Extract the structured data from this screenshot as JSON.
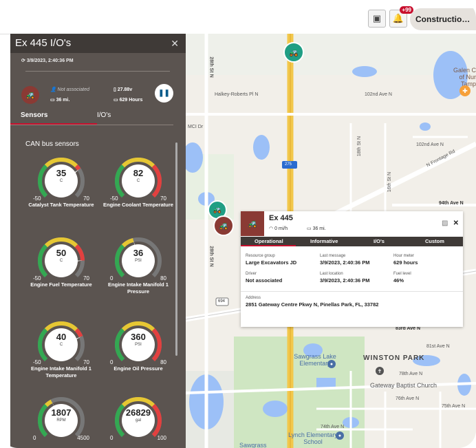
{
  "topbar": {
    "notifications_badge": "+99",
    "org_label": "Constructio…"
  },
  "panel": {
    "title": "Ex 445 I/O's",
    "timestamp": "3/9/2023, 2:40:36 PM",
    "driver": "Not associated",
    "voltage": "27.88v",
    "distance": "36 mi.",
    "hours": "629 Hours",
    "tabs": [
      "Sensors",
      "I/O's"
    ],
    "section_title": "CAN bus sensors"
  },
  "gauges": [
    {
      "value": "35",
      "unit": "C",
      "min": "-50",
      "max": "70",
      "label": "Catalyst Tank Temperature",
      "fraction": 0.71
    },
    {
      "value": "82",
      "unit": "C",
      "min": "-50",
      "max": "70",
      "label": "Engine Coolant Temperature",
      "fraction": 1.0
    },
    {
      "value": "50",
      "unit": "C",
      "min": "-50",
      "max": "70",
      "label": "Engine Fuel Temperature",
      "fraction": 0.83
    },
    {
      "value": "36",
      "unit": "PSI",
      "min": "0",
      "max": "80",
      "label": "Engine Intake Manifold 1 Pressure",
      "fraction": 0.45
    },
    {
      "value": "40",
      "unit": "C",
      "min": "-50",
      "max": "70",
      "label": "Engine Intake Manifold 1 Temperature",
      "fraction": 0.75
    },
    {
      "value": "360",
      "unit": "PSI",
      "min": "0",
      "max": "80",
      "label": "Engine Oil Pressure",
      "fraction": 1.0
    },
    {
      "value": "1807",
      "unit": "RPM",
      "min": "0",
      "max": "4500",
      "label": "",
      "fraction": 0.4
    },
    {
      "value": "26829",
      "unit": "gal",
      "min": "0",
      "max": "100",
      "label": "",
      "fraction": 1.0
    }
  ],
  "map_labels": [
    "Halkey-Roberts Pl N",
    "102nd Ave N",
    "102nd Ave N",
    "N Frontage Rd",
    "94th Ave N",
    "28th St N",
    "28th St N",
    "16th St N",
    "18th St N",
    "MCI Dr",
    "Galen C of Nur Tamp",
    "Sawgrass Lake Elementary",
    "WINSTON PARK",
    "78th Ave N",
    "Gateway Baptist Church",
    "81st Ave N",
    "83rd Ave N",
    "76th Ave N",
    "75th Ave N",
    "74th Ave N",
    "Lynch Elementary School",
    "Sawgrass",
    "694",
    "275"
  ],
  "popup": {
    "title": "Ex 445",
    "speed": "0 mi/h",
    "odometer": "36 mi.",
    "tabs": [
      "Operational",
      "Informative",
      "I/O's",
      "Custom"
    ],
    "resource_group_label": "Resource group",
    "resource_group": "Large Excavators JD",
    "last_message_label": "Last message",
    "last_message": "3/9/2023, 2:40:36 PM",
    "hour_meter_label": "Hour meter",
    "hour_meter": "629 hours",
    "driver_label": "Driver",
    "driver": "Not associated",
    "last_location_label": "Last location",
    "last_location": "3/9/2023, 2:40:36 PM",
    "fuel_label": "Fuel level",
    "fuel": "46%",
    "address_label": "Address",
    "address": "2851 Gateway Centre Pkwy N, Pinellas Park, FL, 33782"
  },
  "colors": {
    "accent": "#c8102e",
    "panel_bg": "#5b5450",
    "header_bg": "#3f3a37",
    "asset": "#8a3a34",
    "teal": "#1f9e84"
  }
}
